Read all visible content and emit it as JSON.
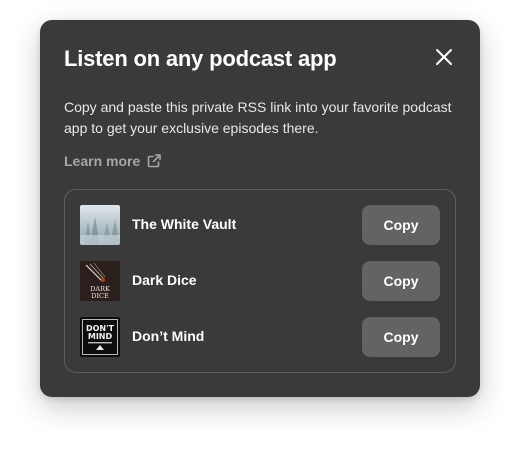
{
  "modal": {
    "title": "Listen on any podcast app",
    "description": "Copy and paste this private RSS link into your favorite podcast app to get your exclusive episodes there.",
    "learn_more_label": "Learn more"
  },
  "icons": {
    "close": "close-icon",
    "external_link": "external-link-icon"
  },
  "podcasts": [
    {
      "name": "The White Vault",
      "copy_label": "Copy",
      "artwork": "snowy-forest-artwork"
    },
    {
      "name": "Dark Dice",
      "copy_label": "Copy",
      "artwork": "dark-dice-artwork"
    },
    {
      "name": "Don’t Mind",
      "copy_label": "Copy",
      "artwork": "dont-mind-artwork"
    }
  ],
  "artwork_text": {
    "dark_dice": "DARK DICE",
    "dont_mind": "DON'T MIND"
  },
  "colors": {
    "modal_background": "#3a3a3a",
    "copy_button": "#636363",
    "muted_text": "#a6a6a6",
    "list_border": "#5f5f5f"
  }
}
